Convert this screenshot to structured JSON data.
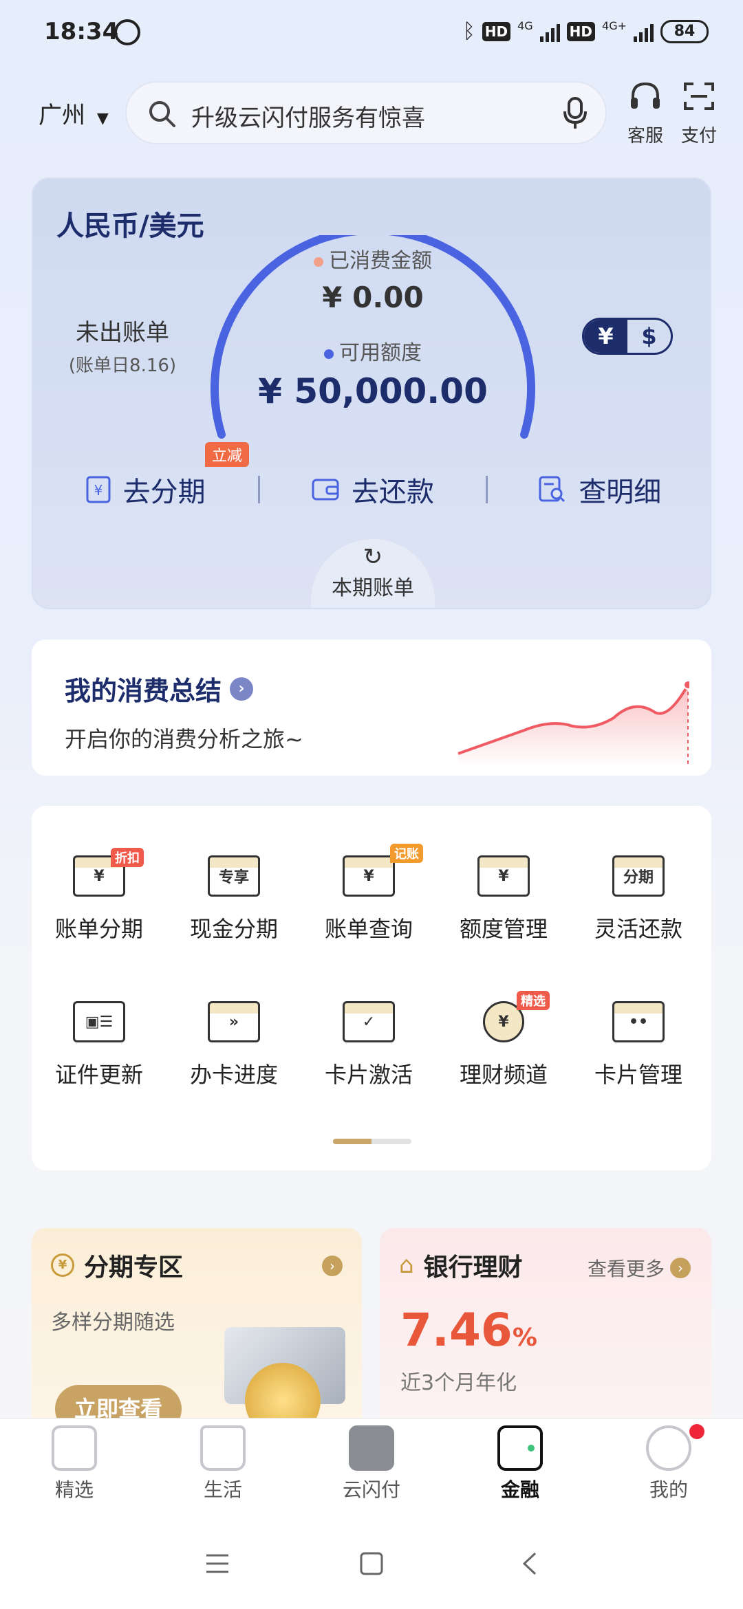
{
  "status_bar": {
    "time": "18:34",
    "hd1": "HD",
    "net1": "4G",
    "hd2": "HD",
    "net2": "4G+",
    "battery": "84"
  },
  "header": {
    "city": "广州",
    "search_placeholder": "升级云闪付服务有惊喜",
    "service_label": "客服",
    "pay_label": "支付"
  },
  "card": {
    "title": "人民币/美元",
    "unbilled": "未出账单",
    "bill_date": "(账单日8.16)",
    "spent_label": "已消费金额",
    "spent_value": "¥ 0.00",
    "available_label": "可用额度",
    "available_value": "¥ 50,000.00",
    "currency_cny": "¥",
    "currency_usd": "$",
    "actions": [
      {
        "label": "去分期",
        "badge": "立减"
      },
      {
        "label": "去还款"
      },
      {
        "label": "查明细"
      }
    ],
    "current_bill": "本期账单",
    "colors": {
      "accent": "#4a63e0",
      "navy": "#1d2d6b",
      "spent_dot": "#f3a08a"
    }
  },
  "summary": {
    "title": "我的消费总结",
    "subtitle": "开启你的消费分析之旅~"
  },
  "services": [
    {
      "label": "账单分期",
      "icon": "bill-installment-icon",
      "glyph": "¥",
      "tag": "折扣"
    },
    {
      "label": "现金分期",
      "icon": "cash-installment-icon",
      "glyph": "专享"
    },
    {
      "label": "账单查询",
      "icon": "bill-query-icon",
      "glyph": "¥",
      "tag": "记账"
    },
    {
      "label": "额度管理",
      "icon": "limit-management-icon",
      "glyph": "¥"
    },
    {
      "label": "灵活还款",
      "icon": "flexible-repayment-icon",
      "glyph": "分期"
    },
    {
      "label": "证件更新",
      "icon": "id-update-icon",
      "glyph": "▣☰"
    },
    {
      "label": "办卡进度",
      "icon": "card-progress-icon",
      "glyph": "»"
    },
    {
      "label": "卡片激活",
      "icon": "card-activation-icon",
      "glyph": "✓"
    },
    {
      "label": "理财频道",
      "icon": "wealth-channel-icon",
      "glyph": "¥",
      "tag": "精选"
    },
    {
      "label": "卡片管理",
      "icon": "card-management-icon",
      "glyph": "••"
    }
  ],
  "promo_left": {
    "title": "分期专区",
    "subtitle": "多样分期随选",
    "button": "立即查看"
  },
  "promo_right": {
    "title": "银行理财",
    "more": "查看更多",
    "rate": "7.46",
    "rate_unit": "%",
    "rate_desc": "近3个月年化"
  },
  "nav": [
    {
      "label": "精选",
      "icon": "featured-icon"
    },
    {
      "label": "生活",
      "icon": "life-icon"
    },
    {
      "label": "云闪付",
      "icon": "unionpay-quickpass-icon"
    },
    {
      "label": "金融",
      "icon": "finance-wallet-icon",
      "active": true
    },
    {
      "label": "我的",
      "icon": "profile-icon"
    }
  ]
}
